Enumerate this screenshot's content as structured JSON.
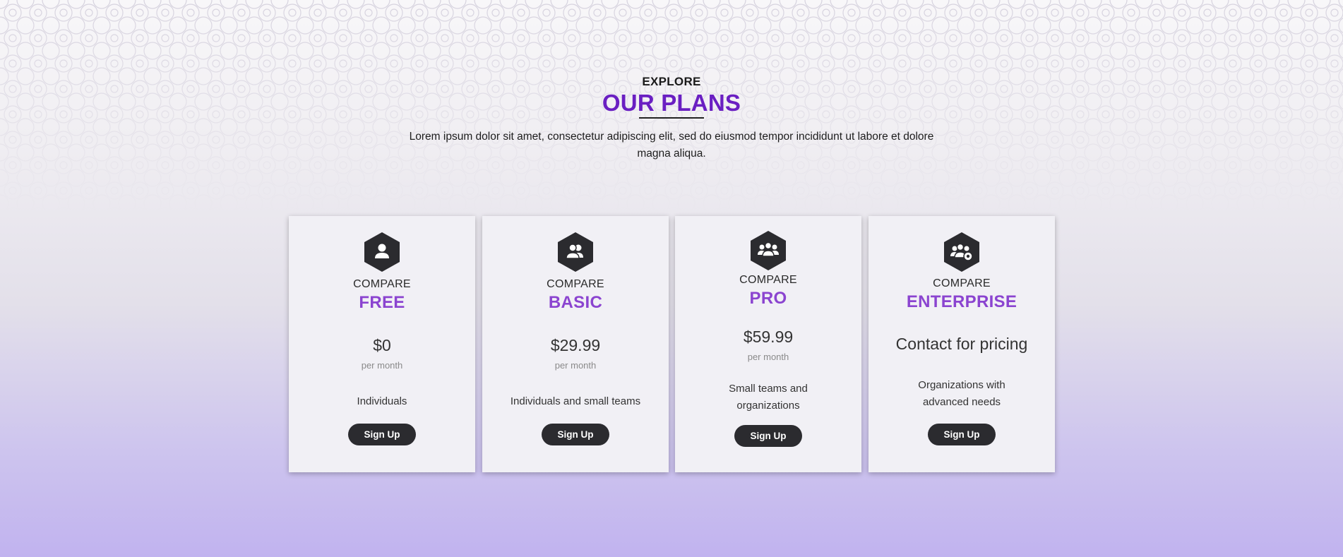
{
  "header": {
    "eyebrow": "EXPLORE",
    "title": "OUR PLANS",
    "description": "Lorem ipsum dolor sit amet, consectetur adipiscing elit, sed do eiusmod tempor incididunt ut labore et dolore magna aliqua."
  },
  "plans": [
    {
      "icon": "single-user-icon",
      "compare_label": "COMPARE",
      "name": "FREE",
      "price": "$0",
      "period": "per month",
      "description": "Individuals",
      "button_label": "Sign Up"
    },
    {
      "icon": "two-users-icon",
      "compare_label": "COMPARE",
      "name": "BASIC",
      "price": "$29.99",
      "period": "per month",
      "description": "Individuals and small teams",
      "button_label": "Sign Up"
    },
    {
      "icon": "team-icon",
      "compare_label": "COMPARE",
      "name": "PRO",
      "price": "$59.99",
      "period": "per month",
      "description": "Small teams and organizations",
      "button_label": "Sign Up"
    },
    {
      "icon": "team-settings-icon",
      "compare_label": "COMPARE",
      "name": "ENTERPRISE",
      "price": "Contact for pricing",
      "description": "Organizations with advanced needs",
      "button_label": "Sign Up"
    }
  ],
  "colors": {
    "accent": "#6a1fc2",
    "plan_name": "#8b44d0",
    "button": "#2b2b2f",
    "icon_hex": "#2b2b2f",
    "card": "#f1f0f5",
    "bg_bottom": "#c1b3ef"
  }
}
